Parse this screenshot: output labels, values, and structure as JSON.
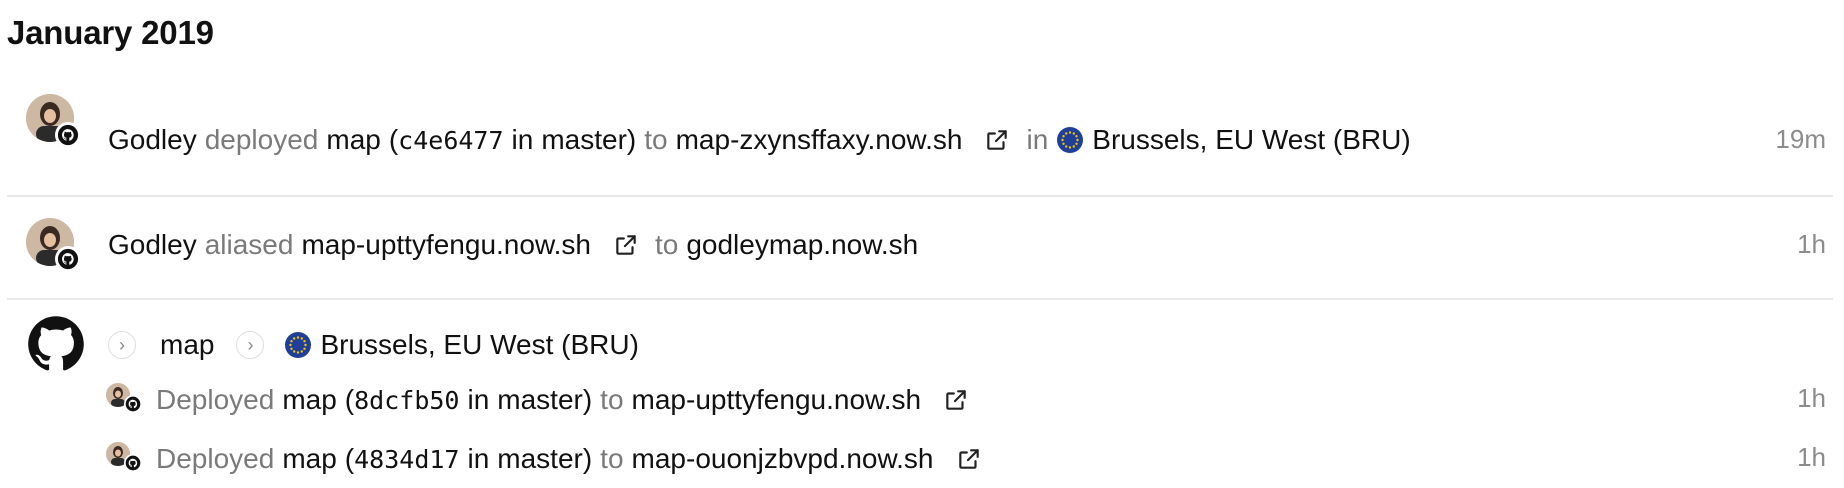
{
  "month_heading": "January 2019",
  "events": [
    {
      "user": "Godley",
      "action": "deployed",
      "project": "map",
      "commit": "c4e6477",
      "in_word": "in",
      "branch": "master",
      "to_word": "to",
      "url": "map-zxynsffaxy.now.sh",
      "location_in": "in",
      "region": "Brussels, EU West (BRU)",
      "time": "19m"
    },
    {
      "user": "Godley",
      "action": "aliased",
      "source_url": "map-upttyfengu.now.sh",
      "to_word": "to",
      "alias": "godleymap.now.sh",
      "time": "1h"
    }
  ],
  "group": {
    "project": "map",
    "region": "Brussels, EU West (BRU)",
    "items": [
      {
        "action": "Deployed",
        "project": "map",
        "commit": "8dcfb50",
        "in_word": "in",
        "branch": "master",
        "to_word": "to",
        "url": "map-upttyfengu.now.sh",
        "time": "1h"
      },
      {
        "action": "Deployed",
        "project": "map",
        "commit": "4834d17",
        "in_word": "in",
        "branch": "master",
        "to_word": "to",
        "url": "map-ouonjzbvpd.now.sh",
        "time": "1h"
      }
    ]
  },
  "icons": {
    "avatar": "user-avatar",
    "badge": "github-icon",
    "external": "external-link-icon",
    "flag": "eu-flag-icon",
    "chevron": "chevron-right-icon"
  },
  "colors": {
    "muted_text": "#7a7a7a",
    "time_text": "#8c8c8c",
    "divider": "#e9e9e9",
    "eu_blue": "#1f3f99",
    "eu_star": "#f5c400"
  }
}
